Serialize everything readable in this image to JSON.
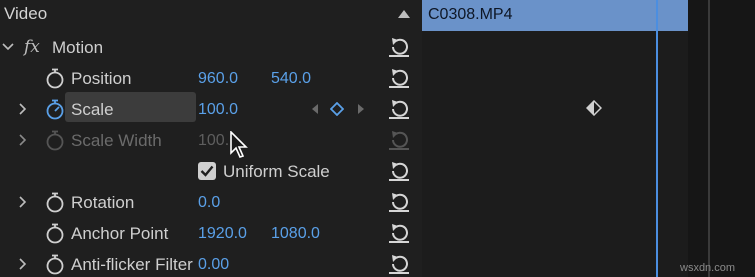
{
  "section": {
    "title": "Video"
  },
  "clip": {
    "name": "C0308.MP4"
  },
  "motion": {
    "fx_symbol": "fx",
    "label": "Motion"
  },
  "properties": {
    "position": {
      "label": "Position",
      "x": "960.0",
      "y": "540.0"
    },
    "scale": {
      "label": "Scale",
      "value": "100.0"
    },
    "scale_width": {
      "label": "Scale Width",
      "value": "100."
    },
    "uniform_scale": {
      "label": "Uniform Scale",
      "checked": true
    },
    "rotation": {
      "label": "Rotation",
      "value": "0.0"
    },
    "anchor_point": {
      "label": "Anchor Point",
      "x": "1920.0",
      "y": "1080.0"
    },
    "anti_flicker": {
      "label": "Anti-flicker Filter",
      "value": "0.00"
    }
  },
  "watermark": "wsxdn.com",
  "colors": {
    "value_blue": "#5aa0e8",
    "clip_blue": "#6a92c9",
    "playhead": "#4b8ee0"
  }
}
